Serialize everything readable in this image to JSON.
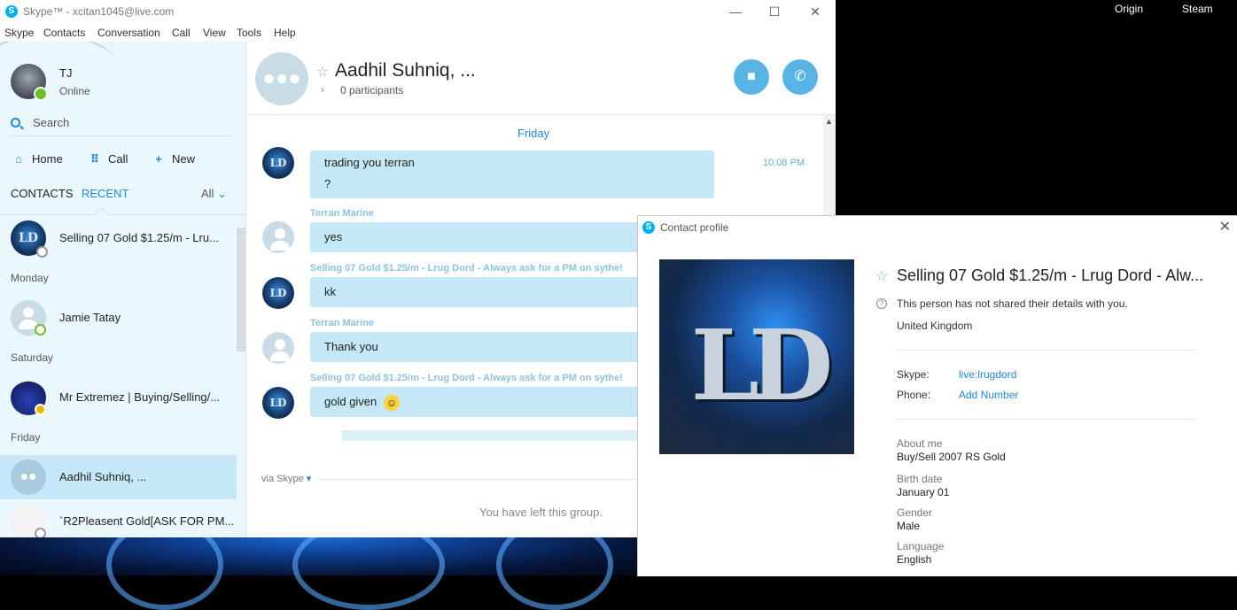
{
  "window": {
    "title": "Skype™ - xcitan1045@live.com",
    "app_icon": "S",
    "controls": {
      "minimize": "—",
      "maximize": "☐",
      "close": "✕"
    }
  },
  "desktop": {
    "taskbar": [
      "Origin",
      "Steam"
    ]
  },
  "menu": [
    "Skype",
    "Contacts",
    "Conversation",
    "Call",
    "View",
    "Tools",
    "Help"
  ],
  "profile": {
    "name": "TJ",
    "status": "Online"
  },
  "search": {
    "placeholder": "Search"
  },
  "nav": {
    "home": "Home",
    "call": "Call",
    "new": "New"
  },
  "tabs": {
    "contacts": "CONTACTS",
    "recent": "RECENT",
    "filter": "All"
  },
  "sidebar": {
    "items": [
      {
        "label": "Selling 07 Gold $1.25/m - Lru..."
      },
      {
        "day": "Monday"
      },
      {
        "label": "Jamie Tatay"
      },
      {
        "day": "Saturday"
      },
      {
        "label": "Mr Extremez | Buying/Selling/..."
      },
      {
        "day": "Friday"
      },
      {
        "label": "Aadhil Suhniq, ..."
      },
      {
        "label": "`R2Pleasent Gold[ASK FOR PM..."
      }
    ]
  },
  "conversation": {
    "title": "Aadhil Suhniq, ...",
    "participants": "0 participants",
    "day": "Friday",
    "messages": [
      {
        "text": "trading you terran",
        "text2": "?",
        "time": "10:08 PM"
      },
      {
        "sender": "Terran Marine",
        "text": "yes"
      },
      {
        "sender": "Selling 07 Gold $1.25/m - Lrug Dord - Always ask for a PM on sythe!",
        "text": "kk"
      },
      {
        "sender": "Terran Marine",
        "text": "Thank you"
      },
      {
        "sender": "Selling 07 Gold $1.25/m - Lrug Dord - Always ask for a PM on sythe!",
        "text": "gold given"
      }
    ],
    "via": "via Skype",
    "left_note": "You have left this group."
  },
  "contact_profile": {
    "window_title": "Contact profile",
    "name": "Selling 07 Gold $1.25/m - Lrug Dord - Alw...",
    "privacy_note": "This person has not shared their details with you.",
    "country": "United Kingdom",
    "skype_label": "Skype:",
    "skype_value": "live:lrugdord",
    "phone_label": "Phone:",
    "phone_value": "Add Number",
    "about_label": "About me",
    "about_value": "Buy/Sell 2007 RS Gold",
    "birth_label": "Birth date",
    "birth_value": "January 01",
    "gender_label": "Gender",
    "gender_value": "Male",
    "language_label": "Language",
    "language_value": "English",
    "image_text": "LD"
  },
  "colors": {
    "accent": "#1e88d6",
    "bubble": "#c5e7f8",
    "sidebar": "#eaf7fd"
  }
}
